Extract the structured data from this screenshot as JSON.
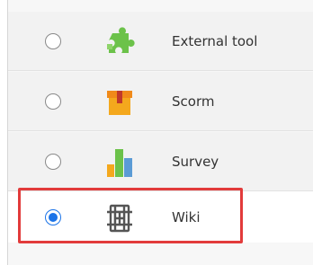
{
  "activities": [
    {
      "label": "External tool",
      "icon": "puzzle-piece-icon",
      "selected": false
    },
    {
      "label": "Scorm",
      "icon": "package-box-icon",
      "selected": false
    },
    {
      "label": "Survey",
      "icon": "bar-chart-icon",
      "selected": false
    },
    {
      "label": "Wiki",
      "icon": "wiki-knot-icon",
      "selected": true
    }
  ],
  "colors": {
    "accent": "#1a73e8",
    "highlight": "#e23b3b",
    "puzzle": "#6cc24a",
    "box": "#f4a81d"
  }
}
